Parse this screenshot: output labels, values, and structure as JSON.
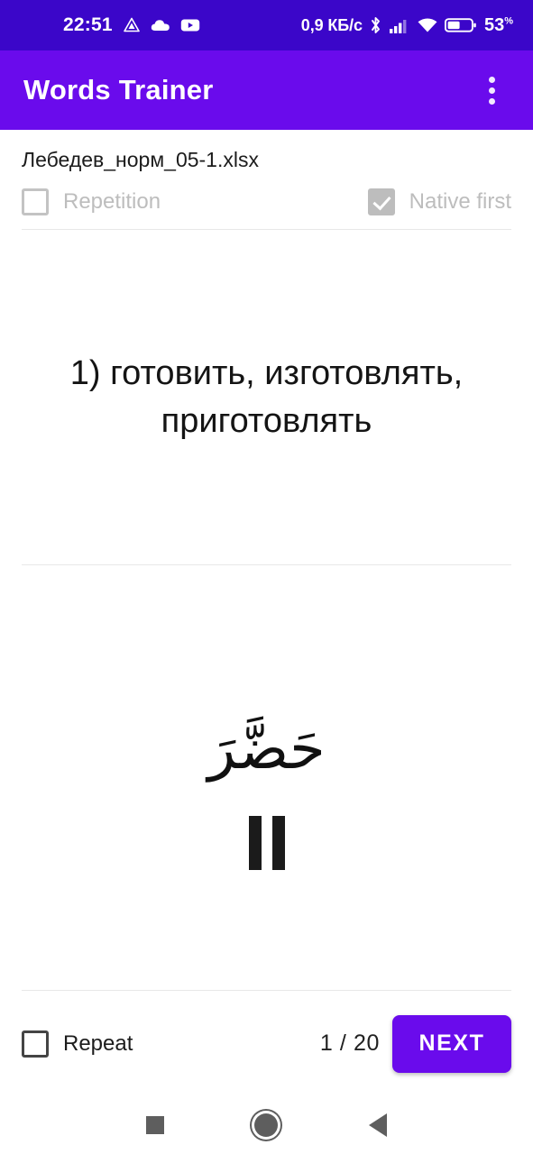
{
  "status_bar": {
    "time": "22:51",
    "icons_left": [
      "triangle-drive-icon",
      "cloud-icon",
      "youtube-icon"
    ],
    "data_speed": "0,9 КБ/с",
    "icons_right": [
      "bluetooth-icon",
      "signal-bars-icon",
      "wifi-icon",
      "battery-icon"
    ],
    "battery_percent": "53",
    "battery_percent_symbol": "%",
    "background_color": "#3b06c9"
  },
  "app_bar": {
    "title": "Words Trainer",
    "overflow_menu_icon": "more-vertical-icon",
    "background_color": "#6a0bec",
    "text_color": "#ffffff"
  },
  "file": {
    "name": "Лебедев_норм_05-1.xlsx"
  },
  "options": {
    "repetition": {
      "label": "Repetition",
      "checked": false,
      "enabled": false
    },
    "native_first": {
      "label": "Native first",
      "checked": true,
      "enabled": false
    }
  },
  "card": {
    "native_text": "1) готовить, изготовлять, приготовлять",
    "foreign_text": "حَضَّرَ",
    "audio_state_icon": "pause-icon"
  },
  "bottom_bar": {
    "repeat": {
      "label": "Repeat",
      "checked": false,
      "enabled": true
    },
    "counter": "1 / 20",
    "next_label": "NEXT",
    "next_color": "#6a0bec"
  },
  "nav_bar": {
    "recents_icon": "square-recents-icon",
    "home_icon": "circle-home-icon",
    "back_icon": "triangle-back-icon"
  }
}
